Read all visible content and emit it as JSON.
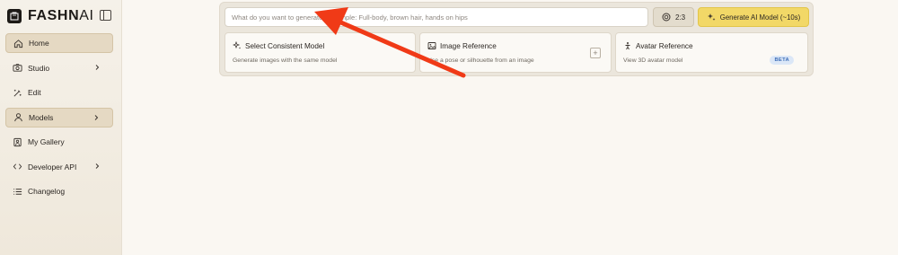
{
  "brand": {
    "name_main": "FASHN",
    "name_ai": "AI"
  },
  "sidebar": {
    "items": [
      {
        "label": "Home",
        "icon": "home-icon",
        "state": "active"
      },
      {
        "label": "Studio",
        "icon": "camera-icon",
        "has_chevron": true
      },
      {
        "label": "Edit",
        "icon": "magic-wand-icon"
      },
      {
        "label": "Models",
        "icon": "user-icon",
        "has_chevron": true,
        "state": "highlighted"
      },
      {
        "label": "My Gallery",
        "icon": "gallery-icon"
      },
      {
        "label": "Developer API",
        "icon": "code-icon",
        "has_chevron": true
      },
      {
        "label": "Changelog",
        "icon": "list-icon"
      }
    ]
  },
  "composer": {
    "prompt_placeholder": "What do you want to generate? Example: Full-body, brown hair, hands on hips",
    "prompt_value": "",
    "ratio_label": "2:3",
    "generate_label": "Generate AI Model (~10s)",
    "generate_color": "#f2d867"
  },
  "cards": [
    {
      "title": "Select Consistent Model",
      "desc": "Generate images with the same model",
      "icon": "sparkle-icon"
    },
    {
      "title": "Image Reference",
      "desc": "Use a pose or silhouette from an image",
      "icon": "image-icon"
    },
    {
      "title": "Avatar Reference",
      "desc": "View 3D avatar model",
      "icon": "person-icon",
      "badge": "BETA"
    }
  ],
  "annotation": {
    "color": "#f03a17",
    "icon": "red-arrow"
  }
}
